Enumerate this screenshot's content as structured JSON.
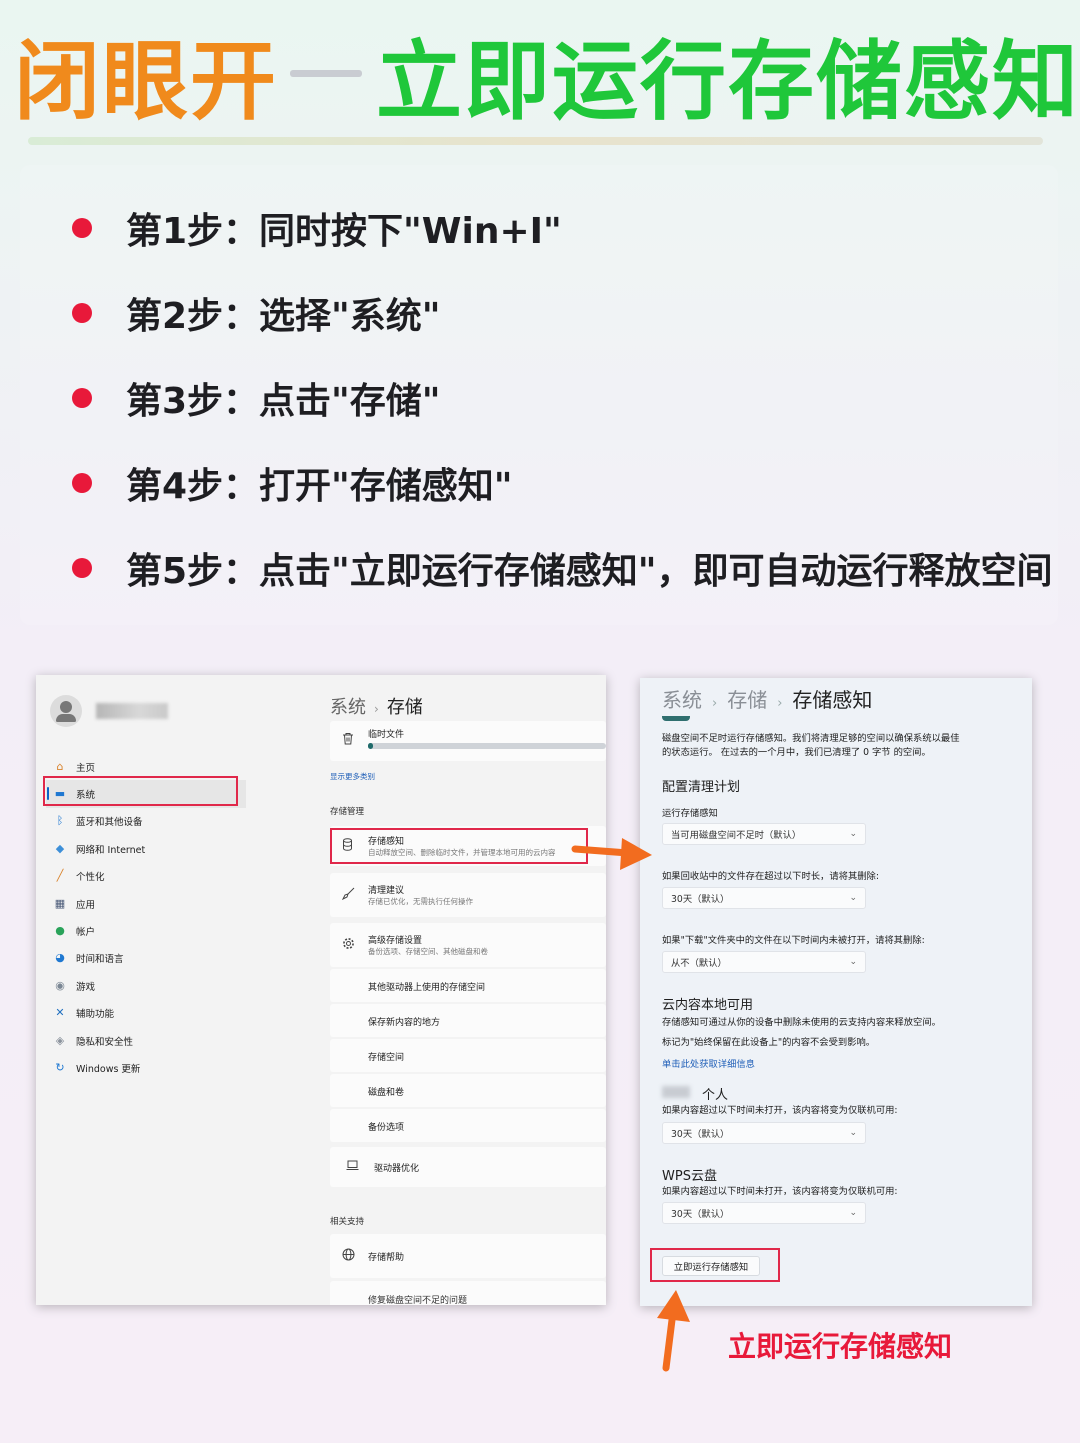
{
  "title": {
    "part1": "闭眼开",
    "part2": "立即运行存储感知"
  },
  "steps": [
    "第1步：同时按下\"Win+I\"",
    "第2步：选择\"系统\"",
    "第3步：点击\"存储\"",
    "第4步：打开\"存储感知\"",
    "第5步：点击\"立即运行存储感知\"，即可自动运行释放空间"
  ],
  "settings": {
    "nav": [
      {
        "label": "主页",
        "icon": "home-icon",
        "color": "#d9822b"
      },
      {
        "label": "系统",
        "icon": "monitor-icon",
        "color": "#1f78d1"
      },
      {
        "label": "蓝牙和其他设备",
        "icon": "bluetooth-icon",
        "color": "#1f78d1"
      },
      {
        "label": "网络和 Internet",
        "icon": "wifi-icon",
        "color": "#3d8fd8"
      },
      {
        "label": "个性化",
        "icon": "brush-icon",
        "color": "#d9822b"
      },
      {
        "label": "应用",
        "icon": "apps-icon",
        "color": "#4a5a78"
      },
      {
        "label": "帐户",
        "icon": "person-icon",
        "color": "#2aa35a"
      },
      {
        "label": "时间和语言",
        "icon": "globe-clock-icon",
        "color": "#1f78d1"
      },
      {
        "label": "游戏",
        "icon": "gamepad-icon",
        "color": "#7b8794"
      },
      {
        "label": "辅助功能",
        "icon": "accessibility-icon",
        "color": "#1f6fbf"
      },
      {
        "label": "隐私和安全性",
        "icon": "shield-icon",
        "color": "#8a929c"
      },
      {
        "label": "Windows 更新",
        "icon": "update-icon",
        "color": "#1f78d1"
      }
    ],
    "breadcrumb": {
      "parent": "系统",
      "current": "存储"
    },
    "temp_files": "临时文件",
    "show_more": "显示更多类别",
    "storage_mgmt": "存储管理",
    "storage_sense": {
      "title": "存储感知",
      "desc": "自动释放空间、删除临时文件，并管理本地可用的云内容"
    },
    "cleanup": {
      "title": "清理建议",
      "desc": "存储已优化，无需执行任何操作"
    },
    "advanced": {
      "title": "高级存储设置",
      "desc": "备份选项、存储空间、其他磁盘和卷"
    },
    "sub_items": [
      "其他驱动器上使用的存储空间",
      "保存新内容的地方",
      "存储空间",
      "磁盘和卷",
      "备份选项"
    ],
    "drive_opt": "驱动器优化",
    "related": "相关支持",
    "help": "存储帮助",
    "fix_link": "修复磁盘空间不足的问题"
  },
  "sense": {
    "breadcrumb": {
      "a": "系统",
      "b": "存储",
      "c": "存储感知"
    },
    "intro1": "磁盘空间不足时运行存储感知。我们将清理足够的空间以确保系统以最佳",
    "intro2": "的状态运行。 在过去的一个月中，我们已清理了 0 字节 的空间。",
    "config_head": "配置清理计划",
    "run_label": "运行存储感知",
    "run_value": "当可用磁盘空间不足时（默认）",
    "recycle_label": "如果回收站中的文件存在超过以下时长，请将其删除:",
    "recycle_value": "30天（默认）",
    "downloads_label": "如果\"下载\"文件夹中的文件在以下时间内未被打开，请将其删除:",
    "downloads_value": "从不（默认）",
    "cloud_head": "云内容本地可用",
    "cloud1": "存储感知可通过从你的设备中删除未使用的云支持内容来释放空间。",
    "cloud2": "标记为\"始终保留在此设备上\"的内容不会受到影响。",
    "cloud_link": "单击此处获取详细信息",
    "personal_head": "个人",
    "personal_label": "如果内容超过以下时间未打开，该内容将变为仅联机可用:",
    "personal_value": "30天（默认）",
    "wps_head": "WPS云盘",
    "wps_label": "如果内容超过以下时间未打开，该内容将变为仅联机可用:",
    "wps_value": "30天（默认）",
    "run_button": "立即运行存储感知"
  },
  "caption": "立即运行存储感知",
  "colors": {
    "orange": "#f08a1c",
    "green": "#1fc73a",
    "red": "#e8193a",
    "arrow": "#f26c1f"
  }
}
